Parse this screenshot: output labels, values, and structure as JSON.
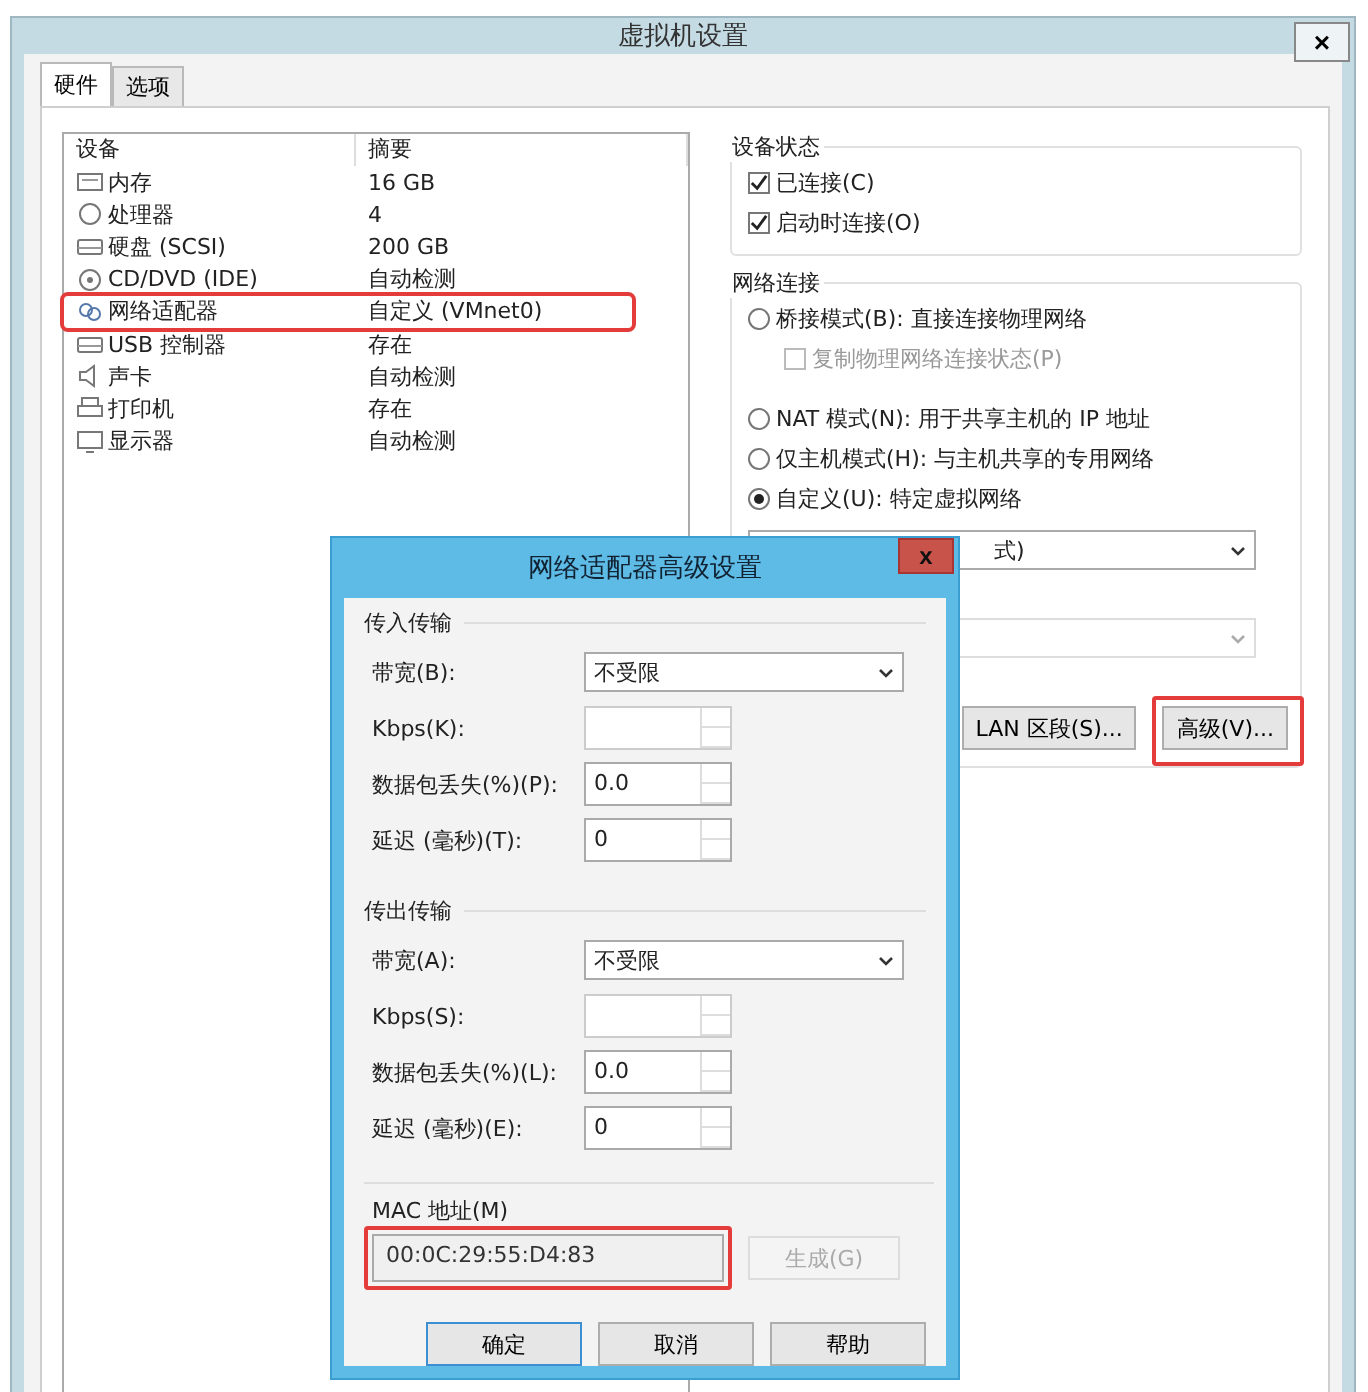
{
  "window": {
    "title": "虚拟机设置",
    "close": "×"
  },
  "tabs": [
    {
      "label": "硬件",
      "selected": true
    },
    {
      "label": "选项",
      "selected": false
    }
  ],
  "device_table": {
    "columns": [
      "设备",
      "摘要"
    ],
    "rows": [
      {
        "device": "内存",
        "summary": "16 GB",
        "highlighted": false
      },
      {
        "device": "处理器",
        "summary": "4",
        "highlighted": false
      },
      {
        "device": "硬盘 (SCSI)",
        "summary": "200 GB",
        "highlighted": false
      },
      {
        "device": "CD/DVD (IDE)",
        "summary": "自动检测",
        "highlighted": false
      },
      {
        "device": "网络适配器",
        "summary": "自定义 (VMnet0)",
        "highlighted": true
      },
      {
        "device": "USB 控制器",
        "summary": "存在",
        "highlighted": false
      },
      {
        "device": "声卡",
        "summary": "自动检测",
        "highlighted": false
      },
      {
        "device": "打印机",
        "summary": "存在",
        "highlighted": false
      },
      {
        "device": "显示器",
        "summary": "自动检测",
        "highlighted": false
      }
    ]
  },
  "device_status": {
    "title": "设备状态",
    "options": [
      {
        "label": "已连接(C)",
        "checked": true
      },
      {
        "label": "启动时连接(O)",
        "checked": true
      }
    ]
  },
  "network_connection": {
    "title": "网络连接",
    "options": [
      {
        "kind": "radio",
        "label": "桥接模式(B): 直接连接物理网络",
        "selected": false
      },
      {
        "kind": "checkbox",
        "label": "复制物理网络连接状态(P)",
        "checked": false,
        "disabled": true
      },
      {
        "kind": "radio",
        "label": "NAT 模式(N): 用于共享主机的 IP 地址",
        "selected": false
      },
      {
        "kind": "radio",
        "label": "仅主机模式(H): 与主机共享的专用网络",
        "selected": false
      },
      {
        "kind": "radio",
        "label": "自定义(U): 特定虚拟网络",
        "selected": true
      }
    ],
    "custom_dropdown": {
      "value": "式)"
    },
    "lan_dropdown": {
      "disabled": true
    },
    "buttons": [
      {
        "label": "LAN 区段(S)...",
        "highlighted": false
      },
      {
        "label": "高级(V)...",
        "highlighted": true
      }
    ]
  },
  "dialog": {
    "title": "网络适配器高级设置",
    "close": "x",
    "groups": [
      {
        "title": "传入传输",
        "bandwidth_label": "带宽(B):",
        "bandwidth": "不受限",
        "kbps_label": "Kbps(K):",
        "loss_label": "数据包丢失(%)(P):",
        "loss": "0.0",
        "latency_label": "延迟 (毫秒)(T):",
        "latency": "0"
      },
      {
        "title": "传出传输",
        "bandwidth_label": "带宽(A):",
        "bandwidth": "不受限",
        "kbps_label": "Kbps(S):",
        "loss_label": "数据包丢失(%)(L):",
        "loss": "0.0",
        "latency_label": "延迟 (毫秒)(E):",
        "latency": "0"
      }
    ],
    "mac": {
      "label": "MAC 地址(M)",
      "value": "00:0C:29:55:D4:83",
      "highlighted": true,
      "generate": "生成(G)"
    },
    "buttons": [
      "确定",
      "取消",
      "帮助"
    ]
  }
}
